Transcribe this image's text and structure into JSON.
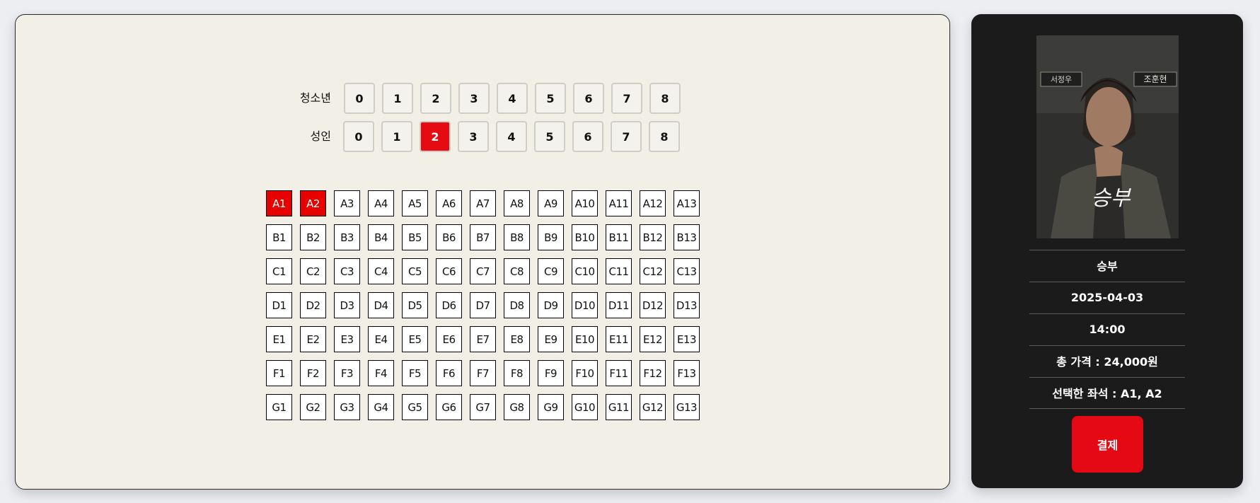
{
  "ticket_counts": {
    "youth": {
      "label": "청소년",
      "colon": ":",
      "options": [
        "0",
        "1",
        "2",
        "3",
        "4",
        "5",
        "6",
        "7",
        "8"
      ],
      "selected": null
    },
    "adult": {
      "label": "성인",
      "colon": ":",
      "options": [
        "0",
        "1",
        "2",
        "3",
        "4",
        "5",
        "6",
        "7",
        "8"
      ],
      "selected": "2"
    }
  },
  "seats": {
    "rows": [
      "A",
      "B",
      "C",
      "D",
      "E",
      "F",
      "G"
    ],
    "columns": 13,
    "selected": [
      "A1",
      "A2"
    ]
  },
  "summary": {
    "movie_title": "승부",
    "date": "2025-04-03",
    "time": "14:00",
    "total_price": "총 가격 : 24,000원",
    "selected_seats": "선택한 좌석 : A1, A2",
    "pay_label": "결제"
  },
  "poster": {
    "title_calligraphy": "승부",
    "name_plates": [
      "서정우",
      "조훈현"
    ]
  },
  "colors": {
    "accent_red": "#e60a12",
    "panel_bg": "#f2f0e6",
    "side_bg": "#1b1b1b"
  }
}
